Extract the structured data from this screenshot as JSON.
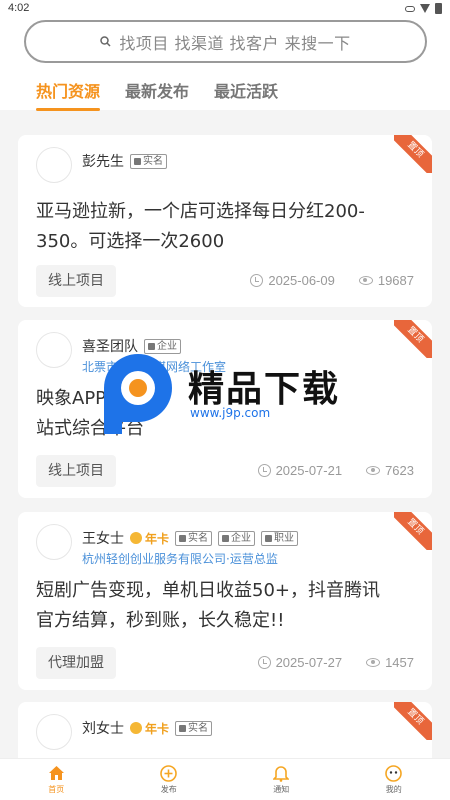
{
  "status_bar": {
    "time": "4:02"
  },
  "search": {
    "placeholder": "找项目 找渠道 找客户 来搜一下"
  },
  "tabs": [
    {
      "label": "热门资源",
      "active": true
    },
    {
      "label": "最新发布",
      "active": false
    },
    {
      "label": "最近活跃",
      "active": false
    }
  ],
  "colors": {
    "accent": "#f5931e",
    "ribbon": "#e8663b",
    "company": "#4a90d9",
    "vip": "#f0a01e"
  },
  "ribbon_label": "置顶",
  "cards": [
    {
      "name": "彭先生",
      "badges": [
        "实名"
      ],
      "title": "亚马逊拉新，一个店可选择每日分红200-350。可选择一次2600",
      "tag": "线上项目",
      "date": "2025-06-09",
      "views": "19687"
    },
    {
      "name": "喜圣团队",
      "badges": [
        "企业"
      ],
      "company": "北票市喜圣传媒网络工作室",
      "title": "映象APP 一站式综合平台",
      "tag": "线上项目",
      "date": "2025-07-21",
      "views": "7623"
    },
    {
      "name": "王女士",
      "vip": "年卡",
      "badges": [
        "实名",
        "企业",
        "职业"
      ],
      "company": "杭州轻创创业服务有限公司·运营总监",
      "title": "短剧广告变现，单机日收益50+，抖音腾讯官方结算，秒到账，长久稳定!!",
      "tag": "代理加盟",
      "date": "2025-07-27",
      "views": "1457"
    },
    {
      "name": "刘女士",
      "vip": "年卡",
      "badges": [
        "实名"
      ]
    }
  ],
  "watermark": {
    "text": "精品下载",
    "url": "www.j9p.com"
  },
  "bottom_nav": [
    {
      "label": "首页",
      "icon": "home-icon",
      "active": true
    },
    {
      "label": "发布",
      "icon": "plus-circle-icon",
      "active": false
    },
    {
      "label": "通知",
      "icon": "bell-icon",
      "active": false
    },
    {
      "label": "我的",
      "icon": "face-icon",
      "active": false
    }
  ]
}
